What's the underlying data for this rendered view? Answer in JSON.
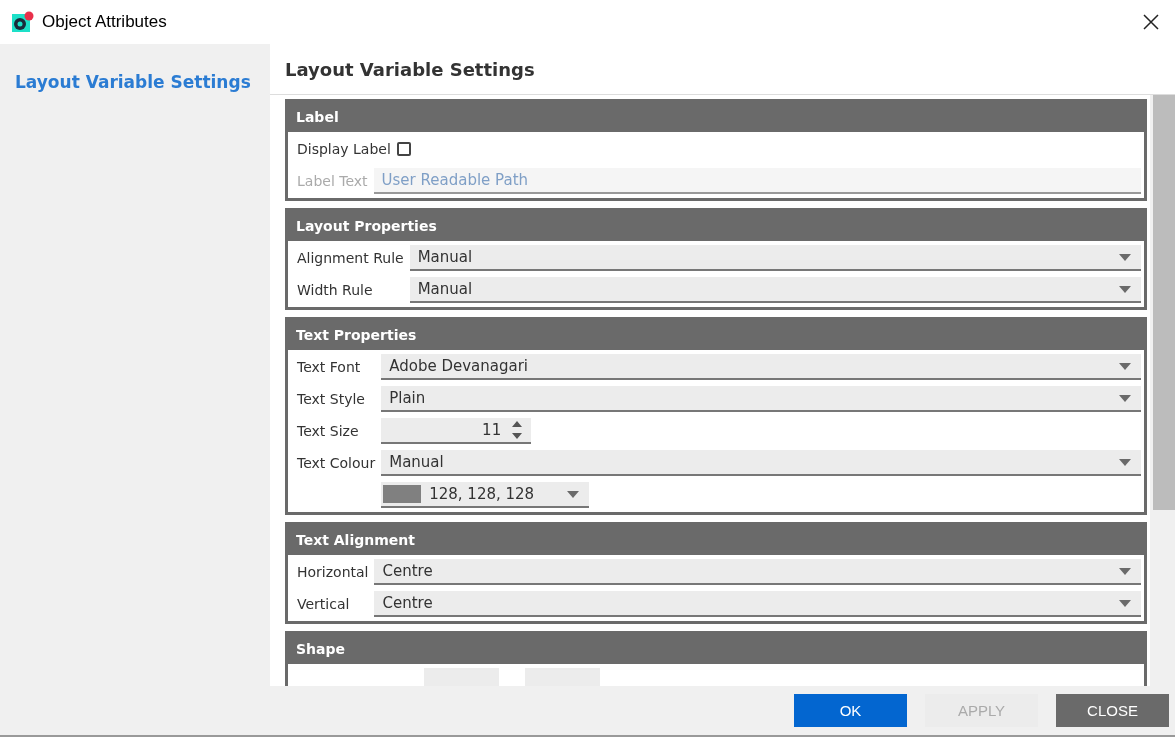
{
  "window": {
    "title": "Object Attributes"
  },
  "sidebar": {
    "items": [
      {
        "label": "Layout Variable Settings",
        "selected": true
      }
    ]
  },
  "main": {
    "title": "Layout Variable Settings",
    "sections": [
      {
        "title": "Label",
        "rows": [
          {
            "kind": "checkbox",
            "label": "Display Label",
            "checked": false
          },
          {
            "kind": "text",
            "label": "Label Text",
            "placeholder": "User Readable Path",
            "disabled": true
          }
        ]
      },
      {
        "title": "Layout Properties",
        "rows": [
          {
            "kind": "dropdown",
            "label": "Alignment Rule",
            "value": "Manual"
          },
          {
            "kind": "dropdown",
            "label": "Width Rule",
            "value": "Manual"
          }
        ]
      },
      {
        "title": "Text Properties",
        "rows": [
          {
            "kind": "dropdown",
            "label": "Text Font",
            "value": "Adobe Devanagari"
          },
          {
            "kind": "dropdown",
            "label": "Text Style",
            "value": "Plain"
          },
          {
            "kind": "spinner",
            "label": "Text Size",
            "value": "11"
          },
          {
            "kind": "dropdown",
            "label": "Text Colour",
            "value": "Manual"
          },
          {
            "kind": "color",
            "value": "128, 128, 128",
            "color": "#808080"
          }
        ]
      },
      {
        "title": "Text Alignment",
        "rows": [
          {
            "kind": "dropdown",
            "label": "Horizontal",
            "value": "Centre"
          },
          {
            "kind": "dropdown",
            "label": "Vertical",
            "value": "Centre"
          }
        ]
      },
      {
        "title": "Shape",
        "rows": [
          {
            "kind": "pair"
          }
        ]
      }
    ]
  },
  "buttons": [
    {
      "label": "OK",
      "kind": "primary",
      "disabled": false
    },
    {
      "label": "APPLY",
      "kind": "plain",
      "disabled": true
    },
    {
      "label": "CLOSE",
      "kind": "dark",
      "disabled": false
    }
  ]
}
